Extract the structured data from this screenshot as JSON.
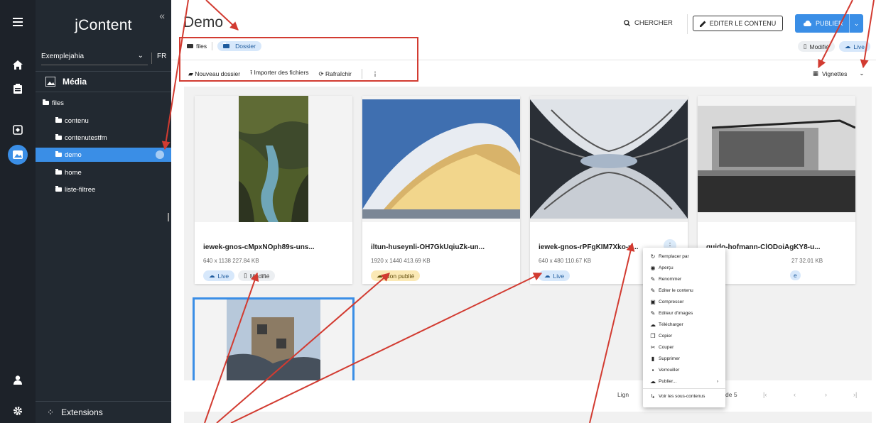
{
  "app": {
    "brand": "jContent",
    "collapse_glyph": "«"
  },
  "site_selector": {
    "value": "Exemplejahia",
    "lang": "FR"
  },
  "accordion": {
    "label": "Média"
  },
  "tree": [
    {
      "label": "files"
    },
    {
      "label": "contenu"
    },
    {
      "label": "contenutestfm"
    },
    {
      "label": "demo"
    },
    {
      "label": "home"
    },
    {
      "label": "liste-filtree"
    }
  ],
  "extensions_label": "Extensions",
  "header": {
    "title": "Demo",
    "search": "CHERCHER",
    "edit": "EDITER LE CONTENU",
    "publish": "PUBLIER"
  },
  "breadcrumb": {
    "root": "files",
    "current": "Dossier"
  },
  "status_top": {
    "modified": "Modifié",
    "live": "Live"
  },
  "toolbar": {
    "new_folder": "Nouveau dossier",
    "import": "Importer des fichiers",
    "refresh": "Rafraîchir"
  },
  "view": {
    "label": "Vignettes"
  },
  "cards": [
    {
      "name": "iewek-gnos-cMpxNOph89s-uns...",
      "meta": "640 x 1138  227.84 KB",
      "badges": [
        {
          "label": "Live",
          "kind": "blue",
          "icon": "cloud-icon"
        },
        {
          "label": "Modifié",
          "kind": "grey",
          "icon": "doc-icon"
        }
      ]
    },
    {
      "name": "iltun-huseynli-OH7GkUqiuZk-un...",
      "meta": "1920 x 1440  413.69 KB",
      "badges": [
        {
          "label": "Non publié",
          "kind": "yellow",
          "icon": "cloud-off-icon"
        }
      ]
    },
    {
      "name": "iewek-gnos-rPFgKIM7Xko-u...",
      "meta": "640 x 480  110.67 KB",
      "badges": [
        {
          "label": "Live",
          "kind": "blue",
          "icon": "cloud-icon"
        }
      ]
    },
    {
      "name": "guido-hofmann-ClODoiAgKY8-u...",
      "meta": "27  32.01 KB",
      "badges": [
        {
          "label": "e",
          "kind": "blue",
          "icon": ""
        }
      ]
    },
    {
      "name": "",
      "meta": "",
      "badges": []
    }
  ],
  "pagination": {
    "label": "Lign",
    "of": "de 5"
  },
  "context_menu": [
    {
      "label": "Remplacer par",
      "icon": "replace-icon"
    },
    {
      "label": "Aperçu",
      "icon": "eye-icon"
    },
    {
      "label": "Renommer",
      "icon": "pencil-icon"
    },
    {
      "label": "Editer le contenu",
      "icon": "pencil-icon"
    },
    {
      "label": "Compresser",
      "icon": "zip-icon"
    },
    {
      "label": "Editeur d'images",
      "icon": "pencil-icon"
    },
    {
      "label": "Télécharger",
      "icon": "cloud-download-icon"
    },
    {
      "label": "Copier",
      "icon": "copy-icon"
    },
    {
      "label": "Couper",
      "icon": "scissors-icon"
    },
    {
      "label": "Supprimer",
      "icon": "trash-icon"
    },
    {
      "label": "Verrouiller",
      "icon": "lock-icon"
    },
    {
      "label": "Publier...",
      "icon": "cloud-icon",
      "submenu": true
    },
    {
      "label": "Voir les sous-contenus",
      "icon": "subdir-icon",
      "separator_before": true
    }
  ],
  "colors": {
    "accent": "#3a8ee6",
    "sidebar": "#222931",
    "rail": "#1d2229",
    "annotation": "#d23b31"
  }
}
